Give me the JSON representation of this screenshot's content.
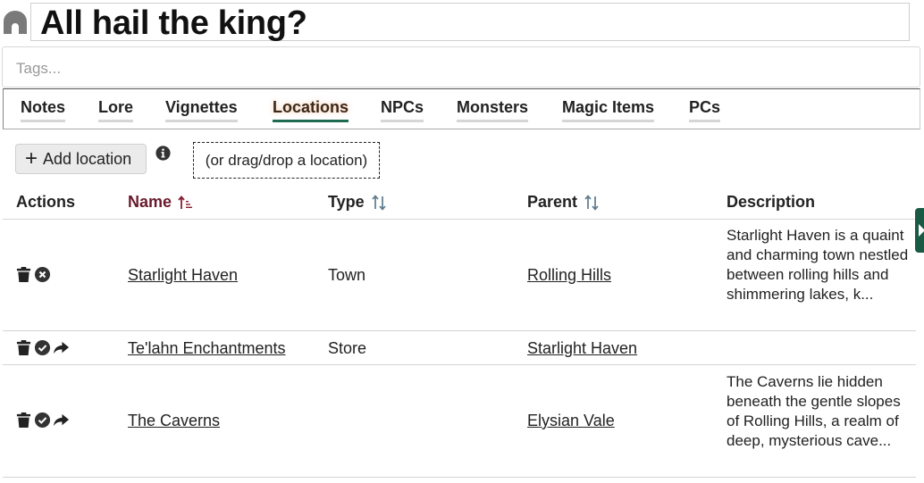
{
  "header": {
    "title": "All hail the king?",
    "tags_placeholder": "Tags..."
  },
  "tabs": [
    {
      "label": "Notes",
      "active": false
    },
    {
      "label": "Lore",
      "active": false
    },
    {
      "label": "Vignettes",
      "active": false
    },
    {
      "label": "Locations",
      "active": true
    },
    {
      "label": "NPCs",
      "active": false
    },
    {
      "label": "Monsters",
      "active": false
    },
    {
      "label": "Magic Items",
      "active": false
    },
    {
      "label": "PCs",
      "active": false
    }
  ],
  "toolbar": {
    "add_label": "Add location",
    "drop_hint": "(or drag/drop a location)"
  },
  "table": {
    "columns": {
      "actions": "Actions",
      "name": "Name",
      "type": "Type",
      "parent": "Parent",
      "description": "Description"
    },
    "sorted_column": "name",
    "rows": [
      {
        "name": "Starlight Haven",
        "type": "Town",
        "parent": "Rolling Hills",
        "description": "Starlight Haven is a quaint and charming town nestled between rolling hills and shimmering lakes, k...",
        "actions": [
          "trash-icon",
          "remove-circle-icon"
        ]
      },
      {
        "name": "Te'lahn Enchantments",
        "type": "Store",
        "parent": "Starlight Haven",
        "description": "",
        "actions": [
          "trash-icon",
          "check-circle-icon",
          "share-arrow-icon"
        ]
      },
      {
        "name": "The Caverns",
        "type": "",
        "parent": "Elysian Vale",
        "description": "The Caverns lie hidden beneath the gentle slopes of Rolling Hills, a realm of deep, mysterious cave...",
        "actions": [
          "trash-icon",
          "check-circle-icon",
          "share-arrow-icon"
        ]
      }
    ]
  },
  "colors": {
    "accent": "#1e6b52",
    "sorted_header": "#6a1a2c",
    "sort_icon": "#5d7a8c",
    "side_tab": "#1a5a44"
  }
}
